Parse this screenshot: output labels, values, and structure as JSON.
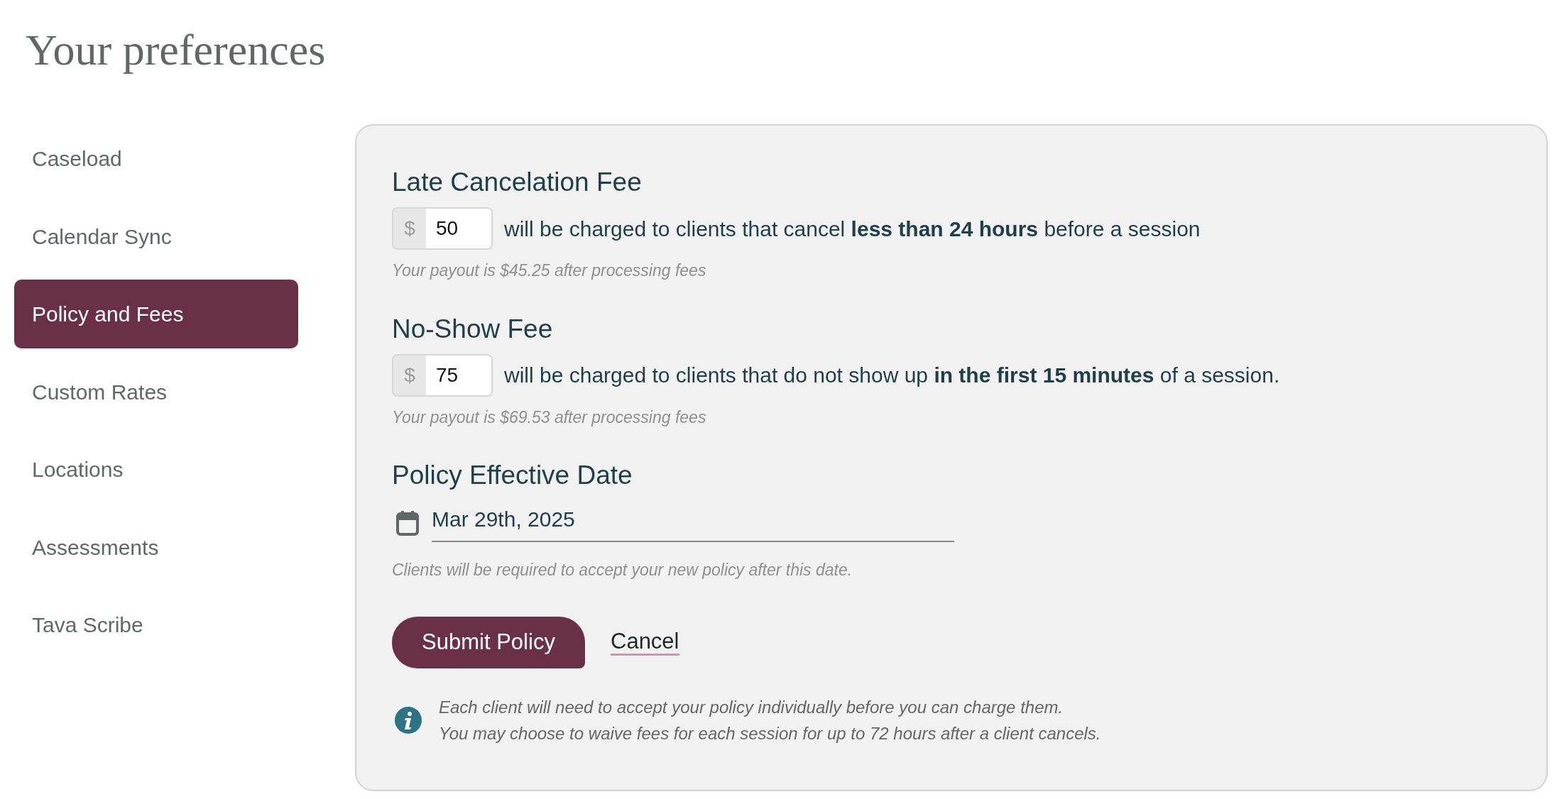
{
  "page": {
    "title": "Your preferences"
  },
  "sidebar": {
    "items": [
      {
        "label": "Caseload",
        "selected": false
      },
      {
        "label": "Calendar Sync",
        "selected": false
      },
      {
        "label": "Policy and Fees",
        "selected": true
      },
      {
        "label": "Custom Rates",
        "selected": false
      },
      {
        "label": "Locations",
        "selected": false
      },
      {
        "label": "Assessments",
        "selected": false
      },
      {
        "label": "Tava Scribe",
        "selected": false
      }
    ]
  },
  "fees": [
    {
      "title": "Late Cancelation Fee",
      "currency": "$",
      "value": "50",
      "description": "will be charged to clients that cancel **less than 24 hours** before a session",
      "payout": "Your payout is $45.25 after processing fees"
    },
    {
      "title": "No-Show Fee",
      "currency": "$",
      "value": "75",
      "description": "will be charged to clients that do not show up **in the first 15 minutes** of a session.",
      "payout": "Your payout is $69.53 after processing fees"
    }
  ],
  "effective_date": {
    "title": "Policy Effective Date",
    "value": "Mar 29th, 2025",
    "hint": "Clients will be required to accept your new policy after this date."
  },
  "actions": {
    "submit": "Submit Policy",
    "cancel": "Cancel"
  },
  "info": [
    "Each client will need to accept your policy individually before you can charge them.",
    "You may choose to waive fees for each session for up to 72 hours after a client cancels."
  ]
}
